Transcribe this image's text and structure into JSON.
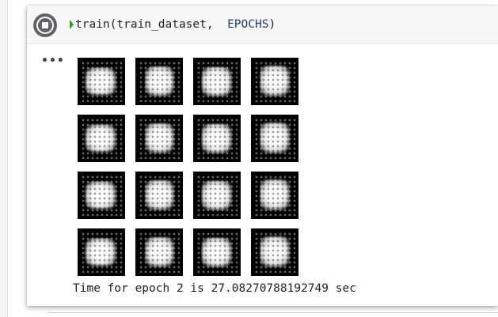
{
  "cell": {
    "code": {
      "function_call": "train(train_dataset,  ",
      "constant": "EPOCHS",
      "closing": ")"
    },
    "run_button_icon": "stop-circle-icon",
    "output_menu_label": "•••",
    "output_text": "Time for epoch 2 is 27.08270788192749 sec",
    "generated_images": {
      "rows": 4,
      "columns": 4,
      "count": 16
    }
  },
  "colors": {
    "run_button": "#5f6368",
    "exec_marker": "#2e9d2e",
    "cell_input_bg": "#f7f7f7"
  }
}
